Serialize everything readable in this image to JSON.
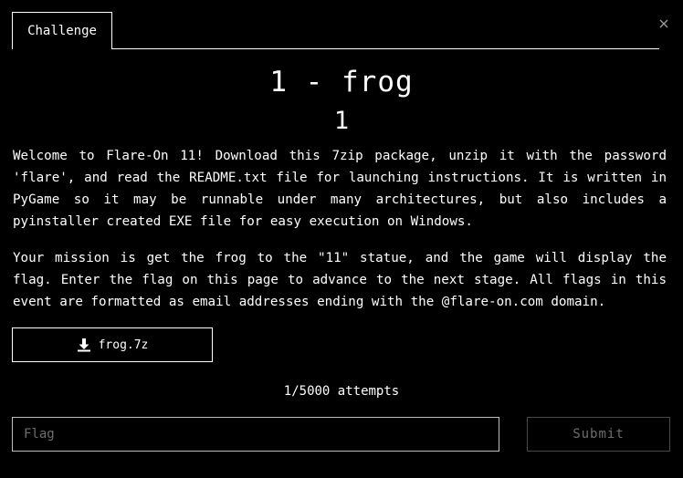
{
  "tabs": [
    {
      "label": "Challenge",
      "active": true
    }
  ],
  "close_icon": "close-icon",
  "challenge": {
    "title": "1 - frog",
    "points": "1",
    "description": [
      "Welcome to Flare-On 11! Download this 7zip package, unzip it with the password 'flare', and read the README.txt file for launching instructions. It is written in PyGame so it may be runnable under many architectures, but also includes a pyinstaller created EXE file for easy execution on Windows.",
      "Your mission is get the frog to the \"11\" statue, and the game will display the flag. Enter the flag on this page to advance to the next stage. All flags in this event are formatted as email addresses ending with the @flare-on.com domain."
    ]
  },
  "download": {
    "icon": "download-icon",
    "label": "frog.7z"
  },
  "attempts": "1/5000 attempts",
  "flag_form": {
    "placeholder": "Flag",
    "value": "",
    "submit_label": "Submit",
    "submit_enabled": false
  },
  "colors": {
    "background": "#000000",
    "foreground": "#ffffff",
    "muted": "#6e6e6e"
  }
}
